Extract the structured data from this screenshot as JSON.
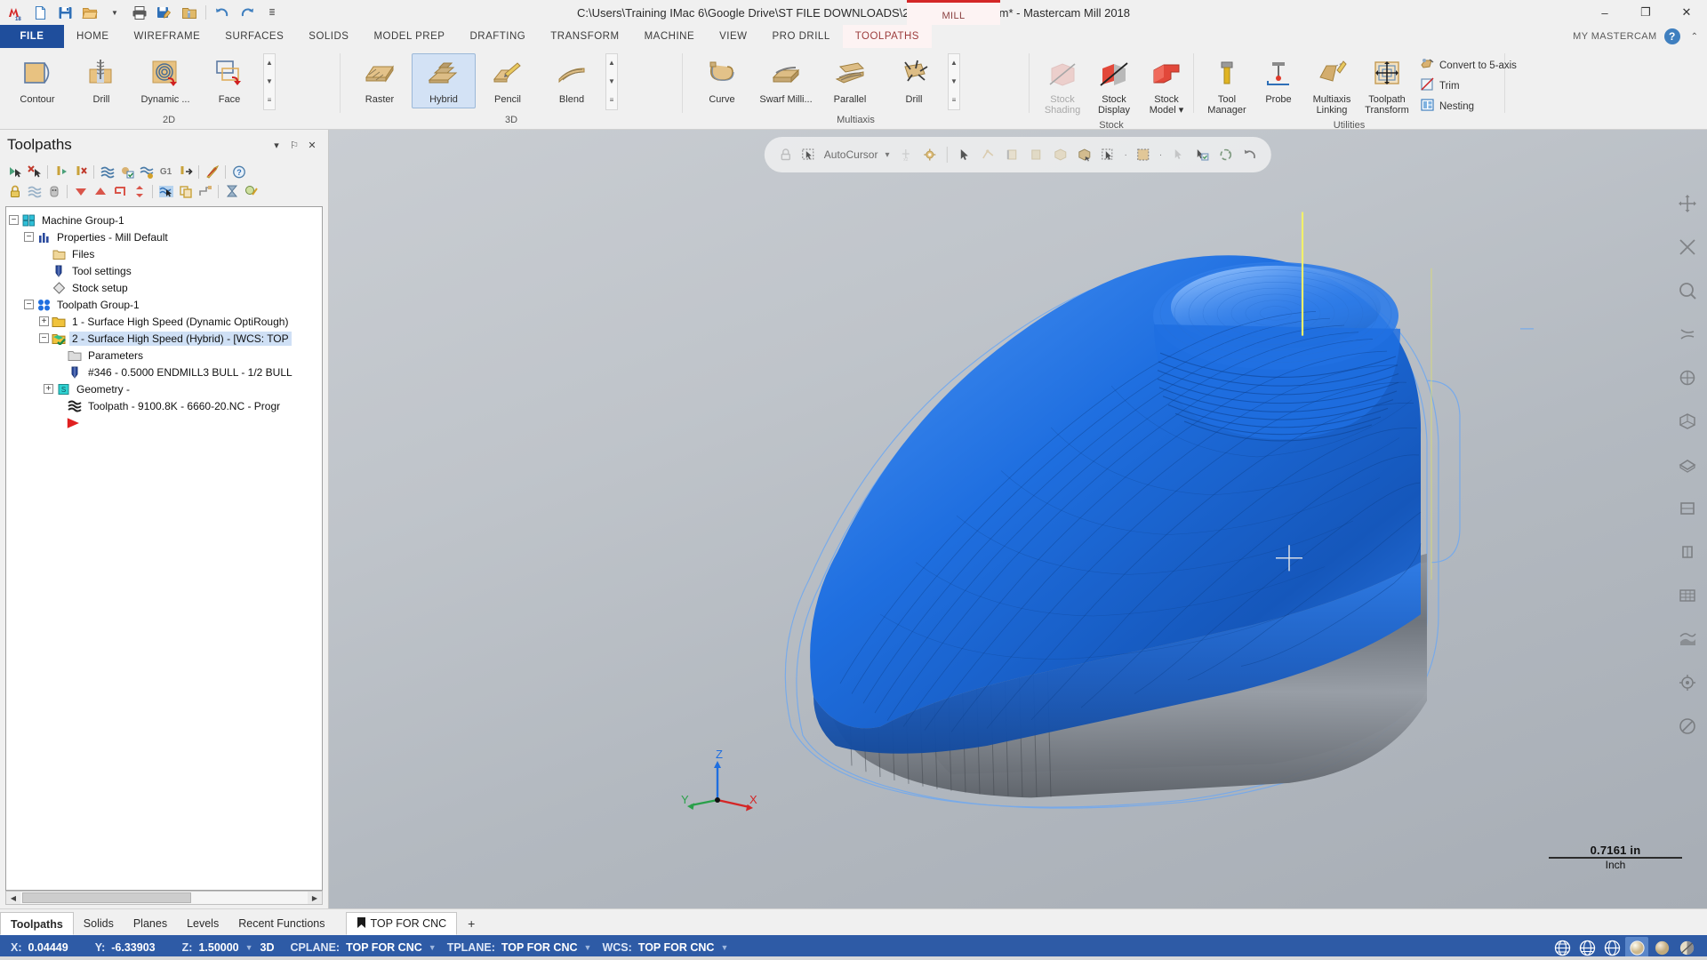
{
  "titlebar": {
    "document_title": "C:\\Users\\Training IMac 6\\Google Drive\\ST FILE DOWNLOADS\\2018\\6660-20.mcam* - Mastercam Mill 2018",
    "machine_tab": "MILL",
    "quick_access": [
      {
        "name": "mastercam-logo-icon",
        "label": "M18"
      },
      {
        "name": "new-file-icon",
        "label": "New"
      },
      {
        "name": "save-icon",
        "label": "Save"
      },
      {
        "name": "open-folder-icon",
        "label": "Open"
      },
      {
        "name": "open-dropdown-icon",
        "label": "Open options"
      },
      {
        "name": "print-icon",
        "label": "Print"
      },
      {
        "name": "save-as-icon",
        "label": "Save As"
      },
      {
        "name": "zip2go-icon",
        "label": "Zip2Go"
      },
      {
        "name": "undo-icon",
        "label": "Undo"
      },
      {
        "name": "redo-icon",
        "label": "Redo"
      },
      {
        "name": "customize-qat-icon",
        "label": "Customize Quick Access Toolbar"
      }
    ],
    "window_buttons": {
      "minimize": "–",
      "maximize": "❐",
      "close": "✕"
    }
  },
  "ribbon_tabs": {
    "file": "FILE",
    "tabs": [
      "HOME",
      "WIREFRAME",
      "SURFACES",
      "SOLIDS",
      "MODEL PREP",
      "DRAFTING",
      "TRANSFORM",
      "MACHINE",
      "VIEW",
      "PRO DRILL",
      "TOOLPATHS"
    ],
    "active": "TOOLPATHS",
    "my_mastercam": "MY MASTERCAM",
    "help_label": "?",
    "collapse_label": "⌃"
  },
  "ribbon": {
    "groups": [
      {
        "title": "2D",
        "buttons": [
          {
            "label": "Contour",
            "icon": "contour-icon",
            "state": "normal"
          },
          {
            "label": "Drill",
            "icon": "drill-2d-icon",
            "state": "normal"
          },
          {
            "label": "Dynamic ...",
            "icon": "dynamic-mill-icon",
            "state": "normal"
          },
          {
            "label": "Face",
            "icon": "face-icon",
            "state": "normal"
          }
        ],
        "spinner": [
          "▲",
          "▼",
          "≡"
        ]
      },
      {
        "title": "3D",
        "buttons": [
          {
            "label": "Raster",
            "icon": "raster-icon",
            "state": "normal"
          },
          {
            "label": "Hybrid",
            "icon": "hybrid-icon",
            "state": "selected"
          },
          {
            "label": "Pencil",
            "icon": "pencil-icon",
            "state": "normal"
          },
          {
            "label": "Blend",
            "icon": "blend-icon",
            "state": "normal"
          }
        ],
        "spinner": [
          "▲",
          "▼",
          "≡"
        ]
      },
      {
        "title": "Multiaxis",
        "buttons": [
          {
            "label": "Curve",
            "icon": "curve-icon",
            "state": "normal"
          },
          {
            "label": "Swarf Milli...",
            "icon": "swarf-milling-icon",
            "state": "normal"
          },
          {
            "label": "Parallel",
            "icon": "parallel-icon",
            "state": "normal"
          },
          {
            "label": "Drill",
            "icon": "multiaxis-drill-icon",
            "state": "normal"
          }
        ],
        "spinner": [
          "▲",
          "▼",
          "≡"
        ]
      },
      {
        "title": "Stock",
        "buttons": [
          {
            "label": "Stock Shading",
            "icon": "stock-shading-icon",
            "state": "disabled"
          },
          {
            "label": "Stock Display",
            "icon": "stock-display-icon",
            "state": "normal"
          },
          {
            "label": "Stock Model ▾",
            "icon": "stock-model-icon",
            "state": "normal"
          }
        ]
      },
      {
        "title": "Utilities",
        "buttons": [
          {
            "label": "Tool Manager",
            "icon": "tool-manager-icon",
            "state": "normal"
          },
          {
            "label": "Probe",
            "icon": "probe-icon",
            "state": "normal"
          },
          {
            "label": "Multiaxis Linking",
            "icon": "multiaxis-linking-icon",
            "state": "normal"
          },
          {
            "label": "Toolpath Transform",
            "icon": "toolpath-transform-icon",
            "state": "normal"
          }
        ],
        "small_buttons": [
          {
            "label": "Convert to 5-axis",
            "icon": "convert-5axis-icon"
          },
          {
            "label": "Trim",
            "icon": "trim-icon"
          },
          {
            "label": "Nesting",
            "icon": "nesting-icon"
          }
        ]
      }
    ]
  },
  "toolpaths_panel": {
    "title": "Toolpaths",
    "header_buttons": [
      {
        "name": "panel-menu-icon",
        "label": "▾"
      },
      {
        "name": "pin-icon",
        "label": "⚐"
      },
      {
        "name": "close-icon",
        "label": "✕"
      }
    ],
    "toolbar_row1": [
      "select-all-icon",
      "deselect-all-icon",
      "sep",
      "regen-selected-icon",
      "delete-selected-icon",
      "sep",
      "regen-dirty-icon",
      "regen-all-dirty-icon",
      "regen-invalid-icon",
      "g1-icon",
      "post-icon",
      "sep",
      "high-feed-icon",
      "sep",
      "help-icon"
    ],
    "toolbar_row2": [
      "lock-icon",
      "toggle-display-icon",
      "toggle-posting-icon",
      "sep",
      "move-down-icon",
      "move-up-icon",
      "move-insert-icon",
      "move-sort-icon",
      "sep",
      "toolpath-select-icon",
      "copy-icon",
      "branch-icon",
      "sep",
      "simulate-icon",
      "verify-icon"
    ],
    "tree": [
      {
        "depth": 0,
        "toggle": "minus",
        "icon": "machine-group-icon",
        "label": "Machine Group-1",
        "selected": false
      },
      {
        "depth": 1,
        "toggle": "minus",
        "icon": "properties-icon",
        "label": "Properties - Mill Default",
        "selected": false
      },
      {
        "depth": 2,
        "toggle": "none",
        "icon": "files-folder-icon",
        "label": "Files",
        "selected": false
      },
      {
        "depth": 2,
        "toggle": "none",
        "icon": "tool-settings-icon",
        "label": "Tool settings",
        "selected": false
      },
      {
        "depth": 2,
        "toggle": "none",
        "icon": "stock-setup-icon",
        "label": "Stock setup",
        "selected": false
      },
      {
        "depth": 1,
        "toggle": "minus",
        "icon": "toolpath-group-icon",
        "label": "Toolpath Group-1",
        "selected": false
      },
      {
        "depth": 2,
        "toggle": "plus",
        "icon": "folder-yellow-icon",
        "label": "1 - Surface High Speed (Dynamic OptiRough)",
        "selected": false
      },
      {
        "depth": 2,
        "toggle": "minus",
        "icon": "folder-green-check-icon",
        "label": "2 - Surface High Speed (Hybrid) - [WCS: TOP",
        "selected": true
      },
      {
        "depth": 3,
        "toggle": "none",
        "icon": "parameters-icon",
        "label": "Parameters",
        "selected": false
      },
      {
        "depth": 3,
        "toggle": "none",
        "icon": "endmill-icon",
        "label": "#346 - 0.5000 ENDMILL3 BULL - 1/2 BULL",
        "selected": false
      },
      {
        "depth": 3,
        "toggle": "plus",
        "icon": "geometry-icon",
        "label": "Geometry -",
        "selected": false
      },
      {
        "depth": 3,
        "toggle": "none",
        "icon": "toolpath-nc-icon",
        "label": "Toolpath - 9100.8K - 6660-20.NC - Progr",
        "selected": false
      },
      {
        "depth": 2,
        "toggle": "none",
        "icon": "insert-arrow-icon",
        "label": "",
        "selected": false
      }
    ],
    "hscroll": {
      "left": "◀",
      "right": "▶"
    }
  },
  "viewport": {
    "toolbar": {
      "lock_icon": "lock-icon",
      "autocursor_icon": "autocursor-icon",
      "autocursor_label": "AutoCursor",
      "dropdown_caret": "▾",
      "icons": [
        "midpoint-snap-icon",
        "gear-snap-icon",
        "sep",
        "select-arrow-icon",
        "select-vector-icon",
        "select-edge-icon",
        "select-face-icon",
        "select-solid-icon",
        "select-body-icon",
        "select-window-icon",
        "dot",
        "select-area-icon",
        "dot",
        "select-wire-icon",
        "quick-mask-icon",
        "rotate-view-icon",
        "undo-select-icon"
      ]
    },
    "right_rail": [
      "fit-icon",
      "unzoom-icon",
      "zoom-window-icon",
      "dynamic-rotate-icon",
      "pan-icon",
      "isometric-icon",
      "top-view-icon",
      "front-view-icon",
      "right-view-icon",
      "wireframe-icon",
      "shaded-icon",
      "levels-icon",
      "analyze-icon",
      "blank-icon"
    ],
    "axis_triad": {
      "x": "X",
      "y": "Y",
      "z": "Z"
    },
    "scale": {
      "value": "0.7161 in",
      "unit": "Inch"
    }
  },
  "bottom_tabs": {
    "tabs": [
      "Toolpaths",
      "Solids",
      "Planes",
      "Levels",
      "Recent Functions"
    ],
    "active": "Toolpaths",
    "view_tab": {
      "icon": "bookmark-icon",
      "label": "TOP FOR CNC"
    },
    "add_tab": "+"
  },
  "statusbar": {
    "coords": [
      {
        "key": "X:",
        "value": "0.04449"
      },
      {
        "key": "Y:",
        "value": "-6.33903"
      },
      {
        "key": "Z:",
        "value": "1.50000"
      }
    ],
    "mode": "3D",
    "planes": [
      {
        "key": "CPLANE:",
        "value": "TOP FOR CNC"
      },
      {
        "key": "TPLANE:",
        "value": "TOP FOR CNC"
      },
      {
        "key": "WCS:",
        "value": "TOP FOR CNC"
      }
    ],
    "icons": [
      {
        "name": "wireframe-globe-icon",
        "selected": false
      },
      {
        "name": "hidden-line-globe-icon",
        "selected": false
      },
      {
        "name": "shaded-globe-icon",
        "selected": false
      },
      {
        "name": "gouraud-shade-icon",
        "selected": true
      },
      {
        "name": "flat-shade-icon",
        "selected": false
      },
      {
        "name": "translucent-shade-icon",
        "selected": false
      }
    ]
  },
  "colors": {
    "accent_blue": "#2e5ba6",
    "file_tab_blue": "#1f4e9c",
    "mill_red": "#d42626",
    "model_blue": "#1f6fe0",
    "selection": "#cfe0f5"
  }
}
